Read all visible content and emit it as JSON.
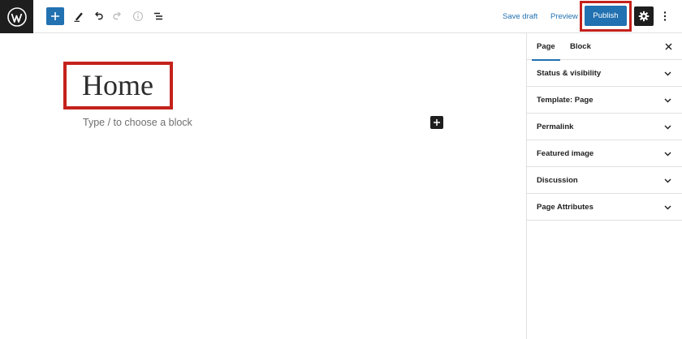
{
  "toolbar": {
    "save_draft_label": "Save draft",
    "preview_label": "Preview",
    "publish_label": "Publish",
    "icons": [
      "wordpress-logo-icon",
      "plus-icon",
      "pencil-icon",
      "undo-icon",
      "redo-icon",
      "info-icon",
      "list-view-icon",
      "gear-icon",
      "more-vertical-icon"
    ]
  },
  "editor": {
    "title": "Home",
    "block_placeholder": "Type / to choose a block"
  },
  "sidebar": {
    "tabs": [
      {
        "label": "Page",
        "active": true
      },
      {
        "label": "Block",
        "active": false
      }
    ],
    "panels": [
      {
        "label": "Status & visibility"
      },
      {
        "label": "Template: Page"
      },
      {
        "label": "Permalink"
      },
      {
        "label": "Featured image"
      },
      {
        "label": "Discussion"
      },
      {
        "label": "Page Attributes"
      }
    ]
  },
  "colors": {
    "accent": "#2271b1",
    "highlight": "#c4221c",
    "dark": "#1e1e1e",
    "border": "#e0e0e0"
  }
}
